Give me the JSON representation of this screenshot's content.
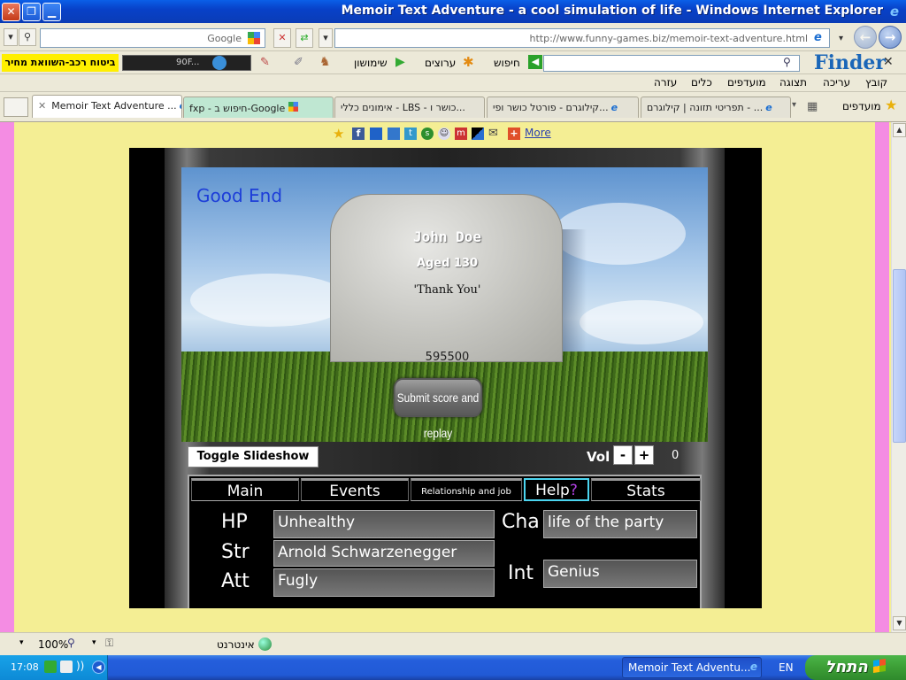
{
  "window": {
    "title": "Memoir Text Adventure - a cool simulation of life - Windows Internet Explorer",
    "close": "✕",
    "restore": "❐",
    "minimize": "▁"
  },
  "address_bar": {
    "url": "http://www.funny-games.biz/memoir-text-adventure.html",
    "search_placeholder": "Google"
  },
  "finder_toolbar": {
    "brand": "Finder",
    "items": [
      "חיפוש",
      "ערוצים",
      "שימושון"
    ],
    "promo": "ביטוח רכב-השוואת מחיר",
    "weather": "90F..."
  },
  "menu": [
    "קובץ",
    "עריכה",
    "תצוגה",
    "מועדפים",
    "כלים",
    "עזרה"
  ],
  "favorites_label": "מועדפים",
  "tabs": [
    {
      "label": "Memoir Text Adventure ..."
    },
    {
      "label": "fxp - חיפוש ב-Google"
    },
    {
      "label": "LBS - כושר ו..."
    },
    {
      "label": "אימונים כללי - LBS - כושר ו..."
    },
    {
      "label": "קילוגרם - פורטל כושר ופי..."
    },
    {
      "label": "תפריטי תזונה | קילוגרם - ..."
    }
  ],
  "share_bar": {
    "more": "More"
  },
  "game": {
    "ending": "Good End",
    "name": "John Doe",
    "aged": "Aged 130",
    "quote": "'Thank You'",
    "score": "595500",
    "submit": "Submit score and replay",
    "toggle_slideshow": "Toggle Slideshow",
    "vol_label": "Vol",
    "vol_minus": "-",
    "vol_plus": "+",
    "vol_value": "0",
    "tabs": {
      "main": "Main",
      "events": "Events",
      "relationship": "Relationship and job",
      "help": "Help",
      "help_q": "?",
      "stats": "Stats"
    },
    "stats": {
      "hp_label": "HP",
      "hp_value": "Unhealthy",
      "str_label": "Str",
      "str_value": "Arnold Schwarzenegger",
      "att_label": "Att",
      "att_value": "Fugly",
      "cha_label": "Cha",
      "cha_value": "life of the party",
      "int_label": "Int",
      "int_value": "Genius"
    }
  },
  "status_bar": {
    "zone": "אינטרנט",
    "zoom": "100%"
  },
  "taskbar": {
    "start": "התחל",
    "clock": "17:08",
    "lang": "EN",
    "task": "Memoir Text Adventu..."
  },
  "colors": {
    "ending_text": "#1d3ed8",
    "help_border": "#4cd5f0",
    "page_bg": "#f4ee94",
    "side_bar": "#f48ce3"
  }
}
